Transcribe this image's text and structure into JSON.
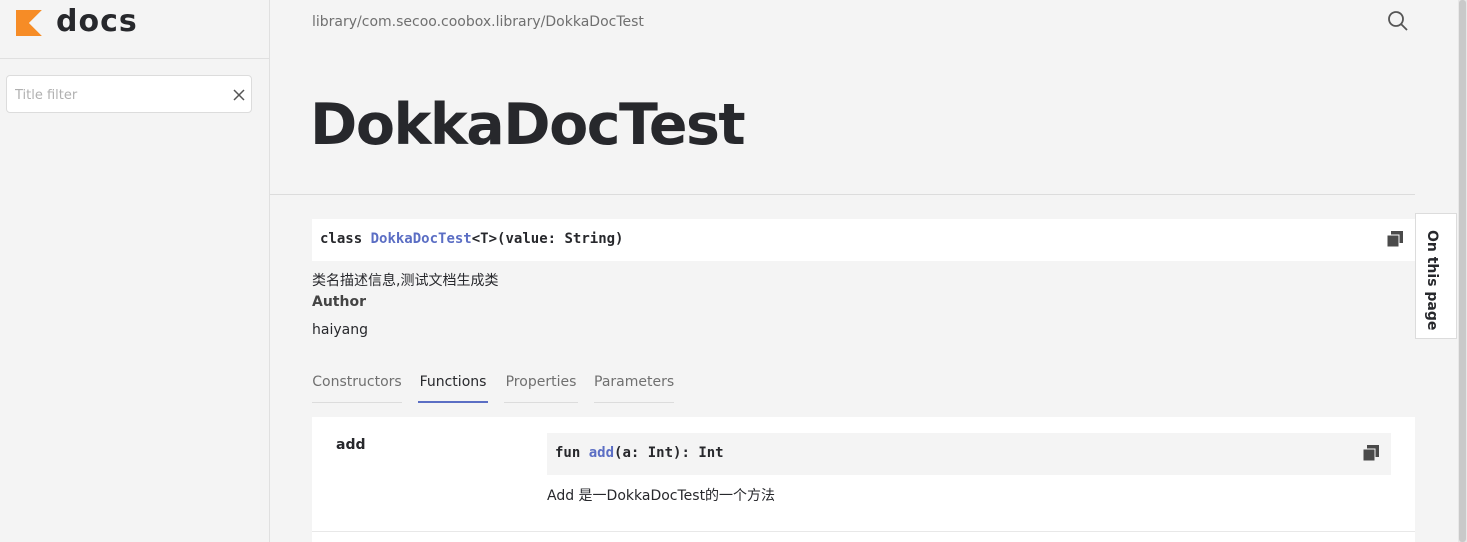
{
  "logo": {
    "text": "docs"
  },
  "sidebar": {
    "filter_placeholder": "Title filter",
    "filter_value": ""
  },
  "breadcrumb": "library/com.secoo.coobox.library/DokkaDocTest",
  "page_title": "DokkaDocTest",
  "signature": {
    "keyword": "class",
    "class_name": "DokkaDocTest",
    "type_param": "<T>",
    "rest": "(value: String)"
  },
  "description": "类名描述信息,测试文档生成类",
  "author": {
    "heading": "Author",
    "value": "haiyang"
  },
  "tabs": [
    {
      "label": "Constructors",
      "active": false
    },
    {
      "label": "Functions",
      "active": true
    },
    {
      "label": "Properties",
      "active": false
    },
    {
      "label": "Parameters",
      "active": false
    }
  ],
  "functions": [
    {
      "name": "add",
      "sig_keyword": "fun",
      "sig_name": "add",
      "sig_rest": "(a: Int): Int",
      "description": "Add 是一DokkaDocTest的一个方法"
    }
  ],
  "on_this_page": "On this page",
  "colors": {
    "accent": "#5b6ec4",
    "logo_orange": "#f68c26",
    "background": "#f4f4f4"
  },
  "icons": {
    "logo": "kotlin-k-icon",
    "search": "search-icon",
    "clear": "close-icon",
    "copy": "copy-icon"
  }
}
